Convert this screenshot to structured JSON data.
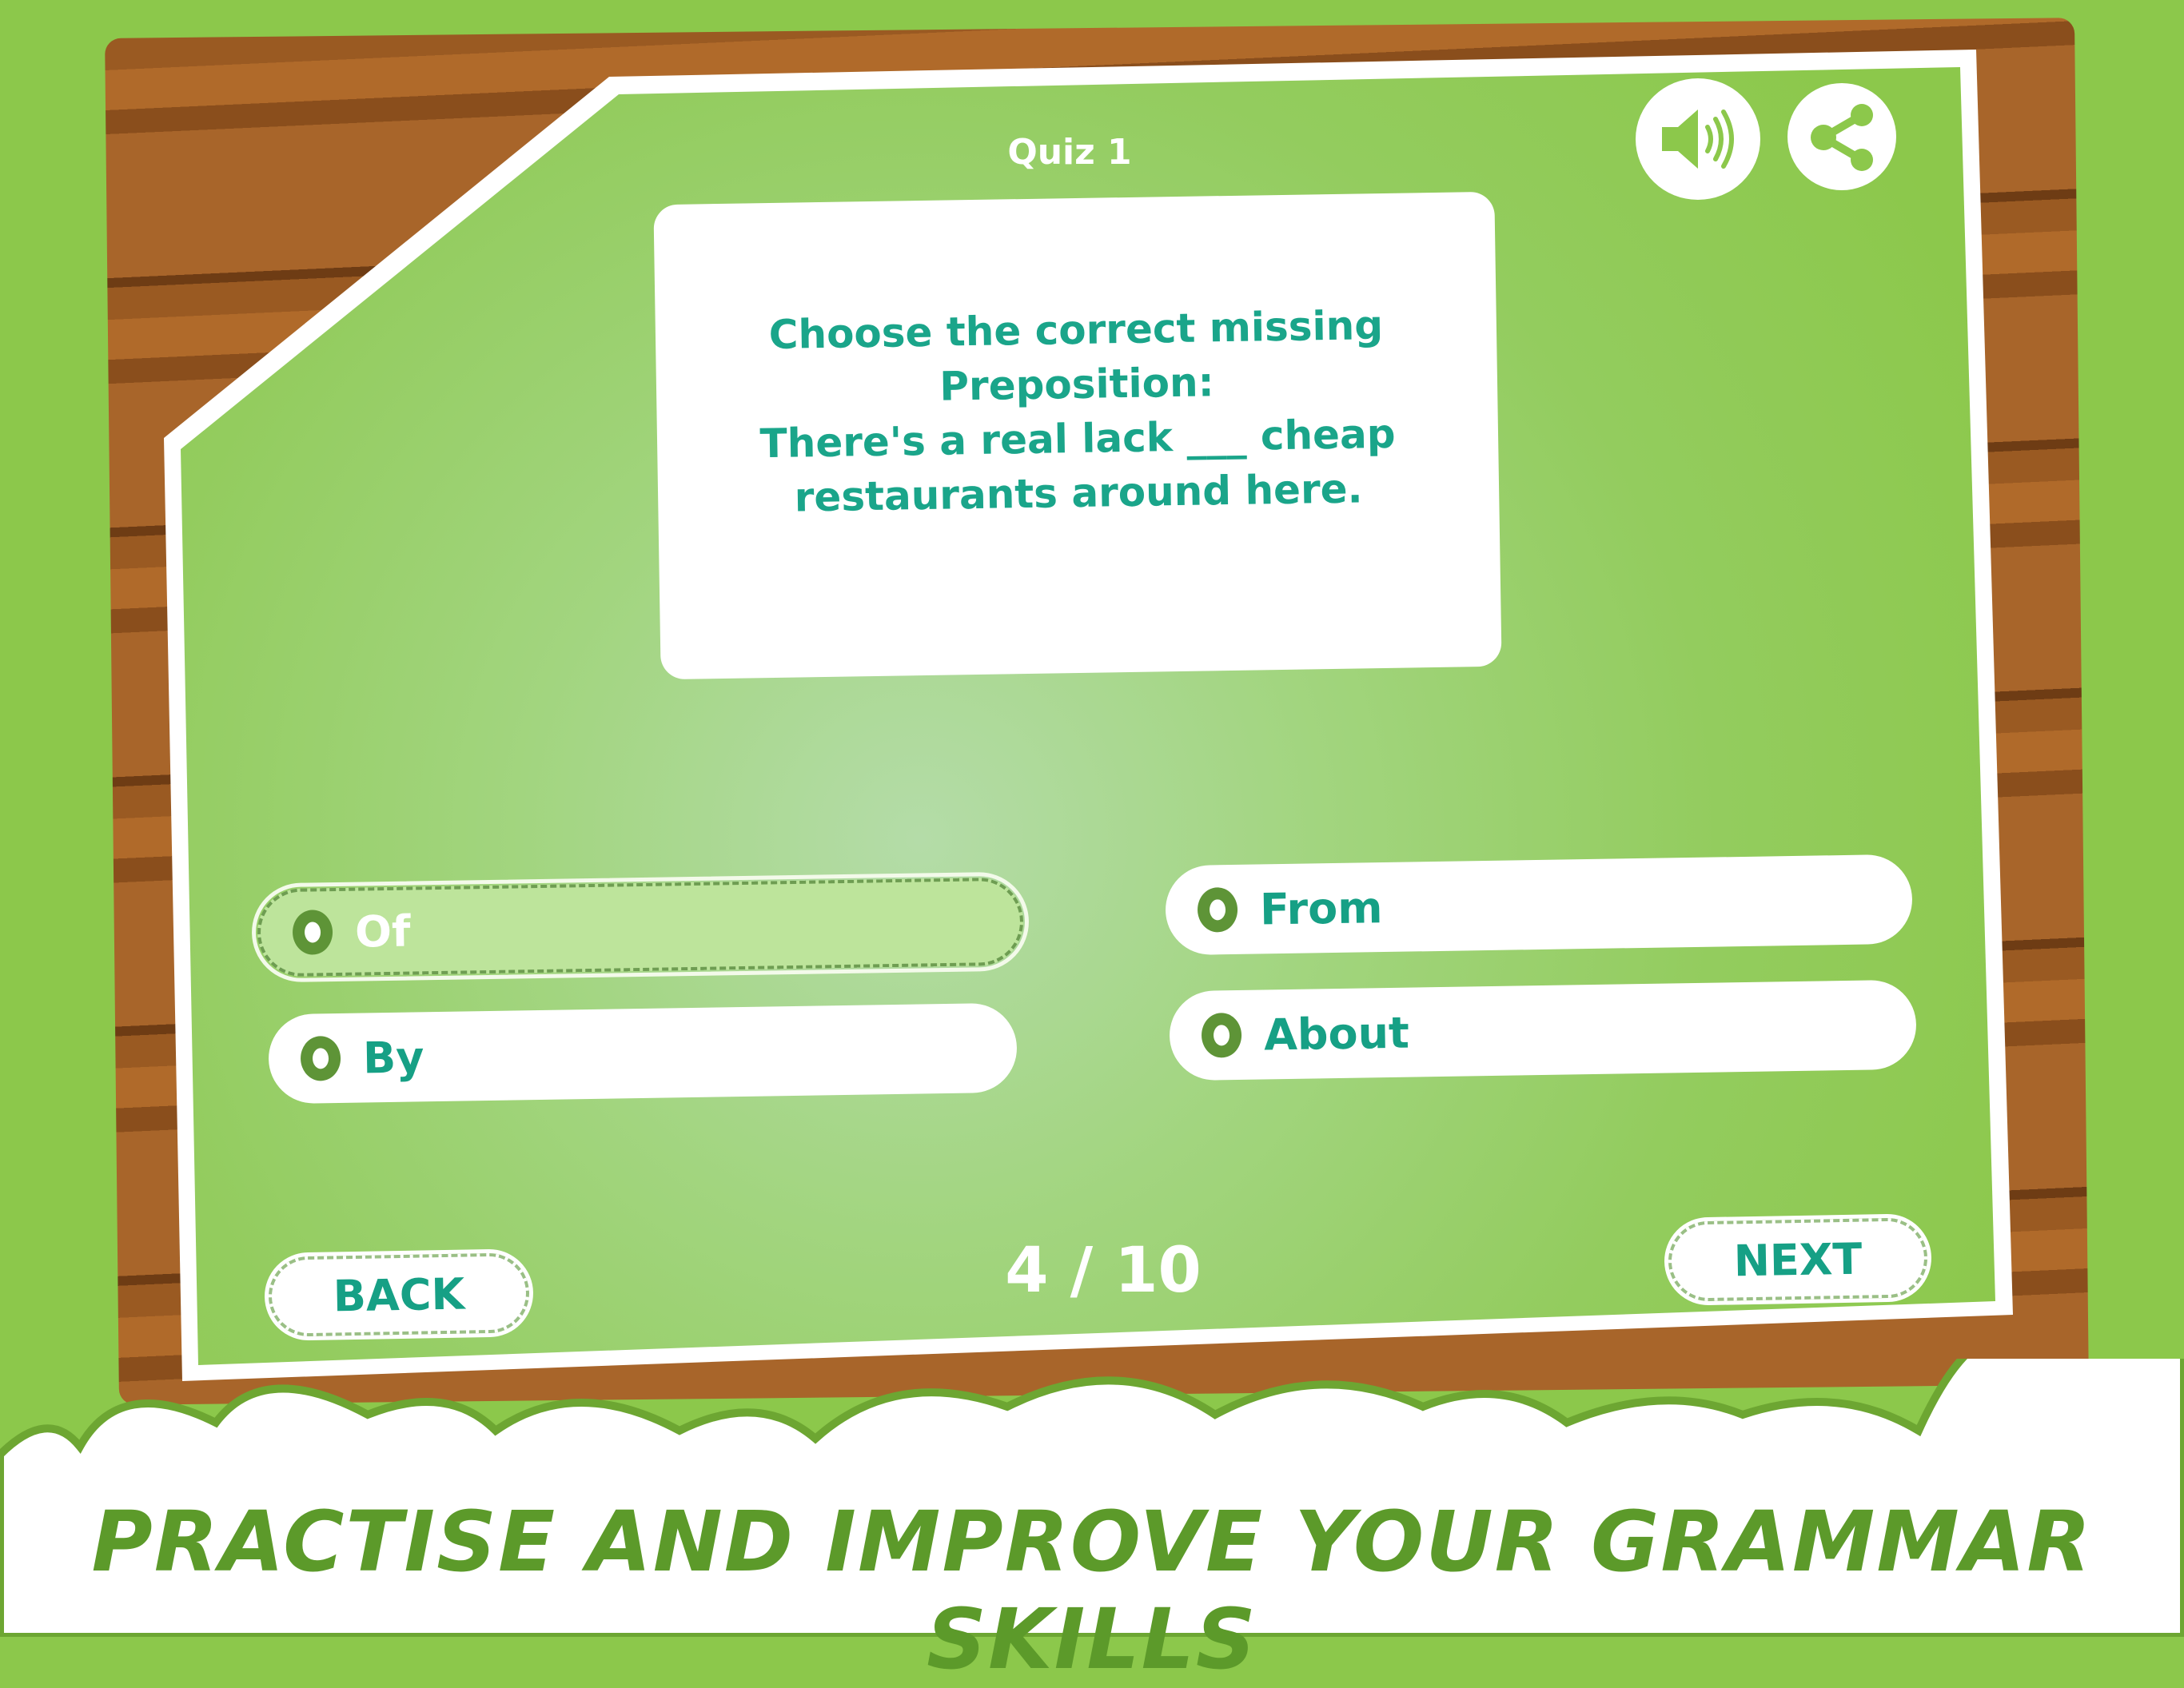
{
  "quiz": {
    "title": "Quiz 1",
    "question": "Choose the correct missing\nPreposition:\nThere's a real lack ___ cheap\nrestaurants around here."
  },
  "toolbar": {
    "sound_icon": "speaker-volume-icon",
    "share_icon": "share-icon"
  },
  "options": [
    {
      "label": "Of",
      "selected": true
    },
    {
      "label": "From",
      "selected": false
    },
    {
      "label": "By",
      "selected": false
    },
    {
      "label": "About",
      "selected": false
    }
  ],
  "nav": {
    "back_label": "BACK",
    "next_label": "NEXT",
    "progress": "4 / 10",
    "current": 4,
    "total": 10
  },
  "banner": "PRACTISE AND IMPROVE YOUR GRAMMAR SKILLS",
  "colors": {
    "accent": "#16a085",
    "green": "#8cc84b",
    "dark_green": "#5e9437"
  }
}
